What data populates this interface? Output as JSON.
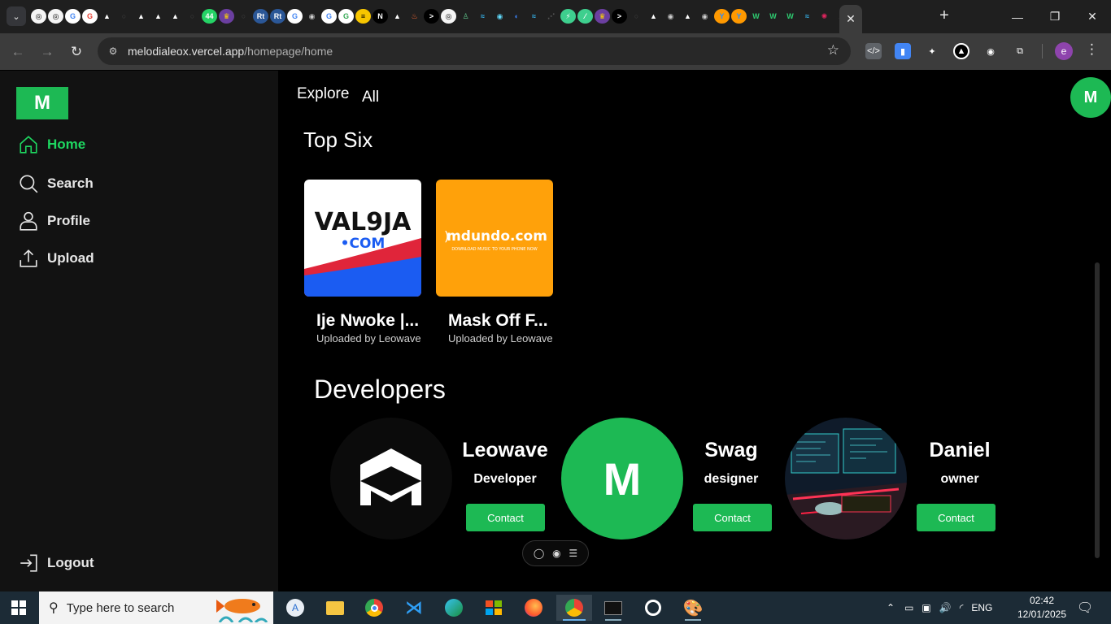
{
  "browser": {
    "url_host": "melodialeox.vercel.app",
    "url_path": "/homepage/home",
    "profile_initial": "e",
    "favicons": [
      {
        "glyph": "◎",
        "bg": "#f5f5f5",
        "fg": "#000"
      },
      {
        "glyph": "◎",
        "bg": "#f5f5f5",
        "fg": "#000"
      },
      {
        "glyph": "G",
        "bg": "#ffffff",
        "fg": "#4285f4"
      },
      {
        "glyph": "G",
        "bg": "#ffffff",
        "fg": "#ea4335"
      },
      {
        "glyph": "▲",
        "bg": "transparent",
        "fg": "#fff"
      },
      {
        "glyph": "○",
        "bg": "transparent",
        "fg": "#444"
      },
      {
        "glyph": "▲",
        "bg": "transparent",
        "fg": "#fff"
      },
      {
        "glyph": "▲",
        "bg": "transparent",
        "fg": "#fff"
      },
      {
        "glyph": "▲",
        "bg": "transparent",
        "fg": "#fff"
      },
      {
        "glyph": "○",
        "bg": "transparent",
        "fg": "#444"
      },
      {
        "glyph": "44",
        "bg": "#25d366",
        "fg": "#fff"
      },
      {
        "glyph": "♛",
        "bg": "#6b3fa0",
        "fg": "#ffd700"
      },
      {
        "glyph": "○",
        "bg": "transparent",
        "fg": "#444"
      },
      {
        "glyph": "Rt",
        "bg": "#2b5797",
        "fg": "#fff"
      },
      {
        "glyph": "Rt",
        "bg": "#2b5797",
        "fg": "#fff"
      },
      {
        "glyph": "G",
        "bg": "#ffffff",
        "fg": "#4285f4"
      },
      {
        "glyph": "◉",
        "bg": "transparent",
        "fg": "#ccc"
      },
      {
        "glyph": "G",
        "bg": "#ffffff",
        "fg": "#4285f4"
      },
      {
        "glyph": "G",
        "bg": "#ffffff",
        "fg": "#34a853"
      },
      {
        "glyph": "≡",
        "bg": "#f7c600",
        "fg": "#000"
      },
      {
        "glyph": "N",
        "bg": "#000",
        "fg": "#fff"
      },
      {
        "glyph": "▲",
        "bg": "transparent",
        "fg": "#fff"
      },
      {
        "glyph": "♨",
        "bg": "transparent",
        "fg": "#ff6b35"
      },
      {
        "glyph": ">",
        "bg": "#000",
        "fg": "#fff"
      },
      {
        "glyph": "◎",
        "bg": "#f5f5f5",
        "fg": "#000"
      },
      {
        "glyph": "♙",
        "bg": "transparent",
        "fg": "#5ec48a"
      },
      {
        "glyph": "≈",
        "bg": "transparent",
        "fg": "#38bdf8"
      },
      {
        "glyph": "◉",
        "bg": "transparent",
        "fg": "#61dafb"
      },
      {
        "glyph": "◐",
        "bg": "transparent",
        "fg": "#3b82f6"
      },
      {
        "glyph": "≈",
        "bg": "transparent",
        "fg": "#38bdf8"
      },
      {
        "glyph": "⋰",
        "bg": "transparent",
        "fg": "#555"
      },
      {
        "glyph": "⚡",
        "bg": "#3ecf8e",
        "fg": "#fff"
      },
      {
        "glyph": "⁄",
        "bg": "#3ecf8e",
        "fg": "#fff"
      },
      {
        "glyph": "♛",
        "bg": "#6b3fa0",
        "fg": "#ffd700"
      },
      {
        "glyph": ">",
        "bg": "#000",
        "fg": "#fff"
      },
      {
        "glyph": "○",
        "bg": "transparent",
        "fg": "#444"
      },
      {
        "glyph": "▲",
        "bg": "transparent",
        "fg": "#fff"
      },
      {
        "glyph": "◉",
        "bg": "transparent",
        "fg": "#ccc"
      },
      {
        "glyph": "▲",
        "bg": "transparent",
        "fg": "#fff"
      },
      {
        "glyph": "◉",
        "bg": "transparent",
        "fg": "#ccc"
      },
      {
        "glyph": "Y",
        "bg": "#ff9900",
        "fg": "#2d8cff"
      },
      {
        "glyph": "Y",
        "bg": "#ff9900",
        "fg": "#2d8cff"
      },
      {
        "glyph": "W",
        "bg": "transparent",
        "fg": "#2ecc71"
      },
      {
        "glyph": "W",
        "bg": "transparent",
        "fg": "#2ecc71"
      },
      {
        "glyph": "W",
        "bg": "transparent",
        "fg": "#2ecc71"
      },
      {
        "glyph": "≈",
        "bg": "transparent",
        "fg": "#38bdf8"
      },
      {
        "glyph": "✺",
        "bg": "transparent",
        "fg": "#e0245e"
      },
      {
        "glyph": "▲",
        "bg": "transparent",
        "fg": "#fff"
      }
    ],
    "extensions": [
      {
        "name": "devtools-ext-icon",
        "glyph": "</>",
        "bg": "#5f6368"
      },
      {
        "name": "doc-ext-icon",
        "glyph": "▮",
        "bg": "#4285f4"
      },
      {
        "name": "color-ext-icon",
        "glyph": "✦",
        "bg": "transparent"
      },
      {
        "name": "vercel-ext-icon",
        "glyph": "▲",
        "bg": "#000"
      },
      {
        "name": "camera-ext-icon",
        "glyph": "◉",
        "bg": "transparent"
      },
      {
        "name": "puzzle-ext-icon",
        "glyph": "⧉",
        "bg": "transparent"
      }
    ]
  },
  "app": {
    "logo": "M",
    "nav": [
      {
        "label": "Home",
        "icon": "home-icon",
        "active": true
      },
      {
        "label": "Search",
        "icon": "search-icon",
        "active": false
      },
      {
        "label": "Profile",
        "icon": "profile-icon",
        "active": false
      },
      {
        "label": "Upload",
        "icon": "upload-icon",
        "active": false
      }
    ],
    "logout": "Logout",
    "header": {
      "explore": "Explore",
      "filter": "All",
      "user_initial": "M"
    },
    "top_six": {
      "title": "Top Six",
      "items": [
        {
          "title": "Ije Nwoke |...",
          "uploader": "Uploaded by Leowave",
          "cover": "val9ja"
        },
        {
          "title": "Mask Off F...",
          "uploader": "Uploaded by Leowave",
          "cover": "mdundo"
        }
      ],
      "covers": {
        "val9ja": {
          "line1": "VAL9JA",
          "line2": "•COM"
        },
        "mdundo": {
          "line1": "mdundo.com",
          "line2": "DOWNLOAD MUSIC TO YOUR PHONE NOW"
        }
      }
    },
    "developers": {
      "title": "Developers",
      "items": [
        {
          "name": "Leowave",
          "role": "Developer",
          "button": "Contact",
          "avatar": "mm-logo"
        },
        {
          "name": "Swag",
          "role": "designer",
          "button": "Contact",
          "avatar": "M"
        },
        {
          "name": "Daniel",
          "role": "owner",
          "button": "Contact",
          "avatar": "desk-photo"
        }
      ]
    },
    "colors": {
      "accent": "#1db954",
      "sidebar_bg": "#121212",
      "mdundo_bg": "#ffa10a"
    }
  },
  "taskbar": {
    "search_placeholder": "Type here to search",
    "language": "ENG",
    "time": "02:42",
    "date": "12/01/2025"
  }
}
